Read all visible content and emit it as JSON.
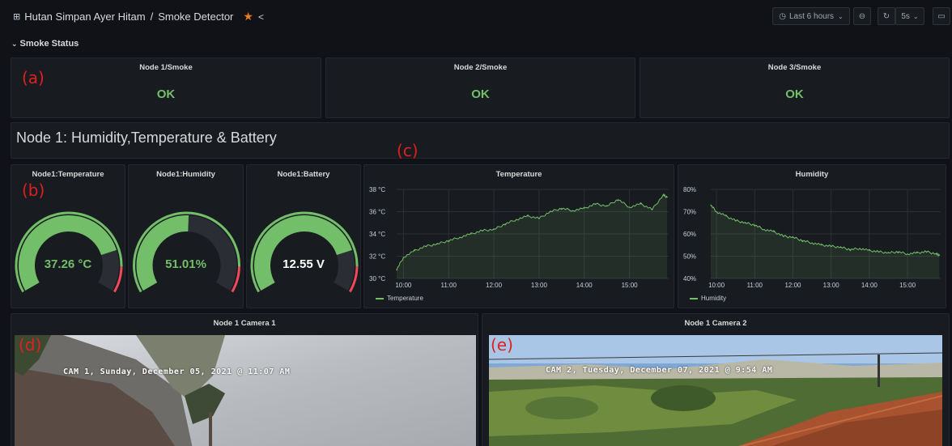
{
  "header": {
    "folder": "Hutan Simpan Ayer Hitam",
    "separator": "/",
    "dashboard": "Smoke Detector",
    "time_range": "Last 6 hours",
    "refresh": "5s"
  },
  "row": {
    "title": "Smoke Status"
  },
  "smoke": [
    {
      "title": "Node 1/Smoke",
      "value": "OK"
    },
    {
      "title": "Node 2/Smoke",
      "value": "OK"
    },
    {
      "title": "Node 3/Smoke",
      "value": "OK"
    }
  ],
  "section_title": "Node 1: Humidity,Temperature & Battery",
  "gauges": [
    {
      "title": "Node1:Temperature",
      "display": "37.26 °C",
      "level": 0.8,
      "min": 0,
      "max": 50
    },
    {
      "title": "Node1:Humidity",
      "display": "51.01%",
      "level": 0.51,
      "min": 0,
      "max": 100
    },
    {
      "title": "Node1:Battery",
      "display": "12.55 V",
      "level": 0.8,
      "min": 0,
      "max": 15
    }
  ],
  "annotations": {
    "a": "(a)",
    "b": "(b)",
    "c": "(c)",
    "d": "(d)",
    "e": "(e)"
  },
  "chart_data": [
    {
      "type": "line",
      "title": "Temperature",
      "x_ticks": [
        "10:00",
        "11:00",
        "12:00",
        "13:00",
        "14:00",
        "15:00"
      ],
      "y_ticks": [
        "30 °C",
        "32 °C",
        "34 °C",
        "36 °C",
        "38 °C"
      ],
      "ylim": [
        30,
        38
      ],
      "grid": true,
      "legend": "bottom-left",
      "series": [
        {
          "name": "Temperature",
          "x": [
            "09:51",
            "10:00",
            "10:15",
            "10:30",
            "10:45",
            "11:00",
            "11:15",
            "11:30",
            "11:45",
            "12:00",
            "12:15",
            "12:30",
            "12:45",
            "13:00",
            "13:15",
            "13:30",
            "13:45",
            "14:00",
            "14:15",
            "14:30",
            "14:45",
            "15:00",
            "15:15",
            "15:30",
            "15:45",
            "15:50"
          ],
          "values": [
            30.8,
            31.9,
            32.5,
            32.9,
            33.1,
            33.4,
            33.7,
            34.0,
            34.3,
            34.4,
            34.9,
            35.3,
            35.6,
            35.4,
            36.0,
            36.3,
            36.1,
            36.3,
            36.7,
            36.5,
            37.1,
            36.4,
            36.7,
            36.2,
            37.5,
            37.3
          ]
        }
      ]
    },
    {
      "type": "line",
      "title": "Humidity",
      "x_ticks": [
        "10:00",
        "11:00",
        "12:00",
        "13:00",
        "14:00",
        "15:00"
      ],
      "y_ticks": [
        "40%",
        "50%",
        "60%",
        "70%",
        "80%"
      ],
      "ylim": [
        40,
        80
      ],
      "grid": true,
      "legend": "bottom-left",
      "series": [
        {
          "name": "Humidity",
          "x": [
            "09:51",
            "10:00",
            "10:15",
            "10:30",
            "10:45",
            "11:00",
            "11:15",
            "11:30",
            "11:45",
            "12:00",
            "12:15",
            "12:30",
            "12:45",
            "13:00",
            "13:15",
            "13:30",
            "13:45",
            "14:00",
            "14:15",
            "14:30",
            "14:45",
            "15:00",
            "15:15",
            "15:30",
            "15:45",
            "15:50"
          ],
          "values": [
            73,
            70,
            68,
            66,
            65,
            64,
            62,
            61,
            59,
            58.5,
            57,
            56,
            55,
            54.5,
            54,
            53,
            53.5,
            52.5,
            52,
            51.5,
            52,
            51,
            51.5,
            52,
            51,
            50.5
          ]
        }
      ]
    }
  ],
  "cameras": [
    {
      "title": "Node 1 Camera 1",
      "overlay": "CAM 1, Sunday, December 05, 2021 @ 11:07 AM"
    },
    {
      "title": "Node 1 Camera 2",
      "overlay": "CAM 2, Tuesday, December 07, 2021 @ 9:54 AM"
    }
  ],
  "colors": {
    "ok": "#73bf69",
    "threshold": "#f2495c",
    "panel": "#181b1f",
    "bg": "#111217",
    "annotation": "#e02020"
  },
  "icons": [
    "dashboard-grid-icon",
    "star-icon",
    "share-icon",
    "clock-icon",
    "zoom-out-icon",
    "refresh-icon",
    "tv-mode-icon"
  ]
}
